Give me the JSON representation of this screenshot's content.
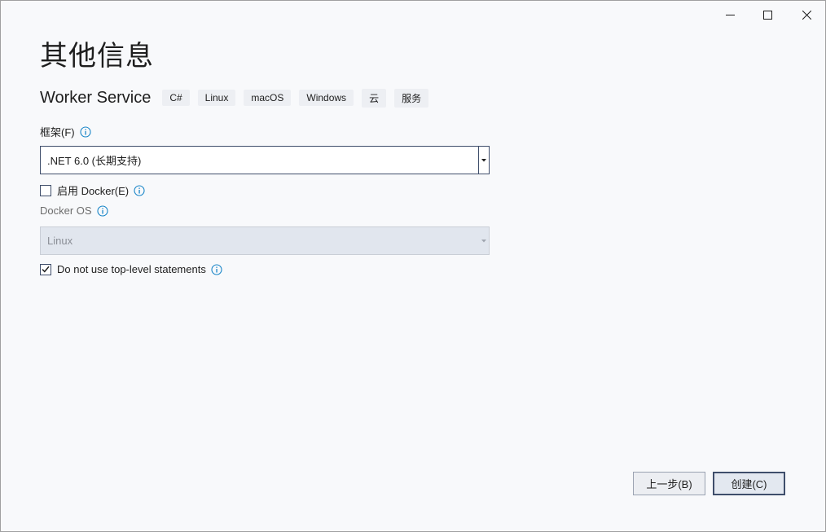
{
  "window": {
    "controls": {
      "minimize_icon": "minimize-icon",
      "maximize_icon": "maximize-icon",
      "close_icon": "close-icon"
    }
  },
  "header": {
    "title": "其他信息"
  },
  "template": {
    "name": "Worker Service",
    "tags": [
      "C#",
      "Linux",
      "macOS",
      "Windows",
      "云",
      "服务"
    ]
  },
  "framework": {
    "label": "框架(F)",
    "selected": ".NET 6.0 (长期支持)"
  },
  "docker": {
    "enable_label": "启用 Docker(E)",
    "enabled": false,
    "os_label": "Docker OS",
    "os_selected": "Linux"
  },
  "top_level": {
    "label": "Do not use top-level statements",
    "checked": true
  },
  "footer": {
    "back_label": "上一步(B)",
    "create_label": "创建(C)"
  },
  "colors": {
    "background": "#f8f9fb",
    "accent": "#3f4e6b",
    "info": "#1a86c8",
    "disabled_fill": "#e1e6ee"
  }
}
